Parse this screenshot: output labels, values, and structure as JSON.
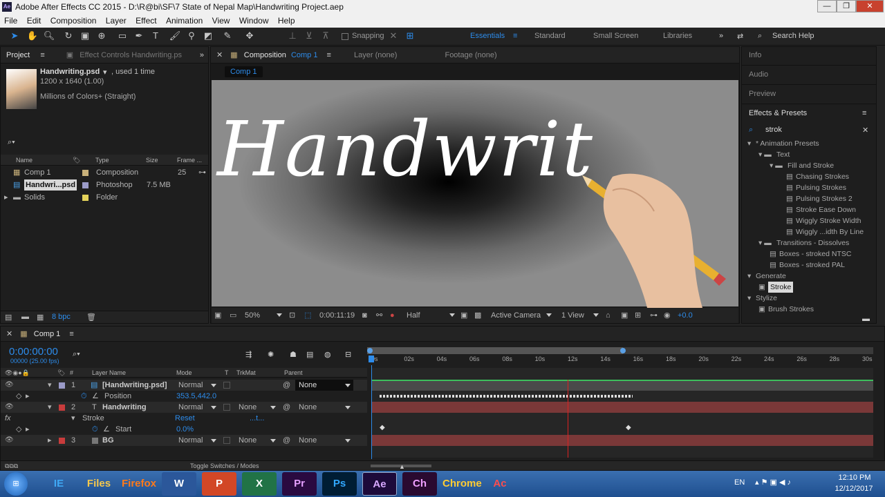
{
  "window": {
    "title": "Adobe After Effects CC 2015 - D:\\R@bi\\SF\\7 State of Nepal Map\\Handwriting Project.aep"
  },
  "menu": [
    "File",
    "Edit",
    "Composition",
    "Layer",
    "Effect",
    "Animation",
    "View",
    "Window",
    "Help"
  ],
  "toolbar": {
    "snapping": "Snapping",
    "workspaces": [
      "Essentials",
      "Standard",
      "Small Screen",
      "Libraries"
    ],
    "search_help": "Search Help"
  },
  "project_panel": {
    "tab": "Project",
    "effect_controls_tab": "Effect Controls Handwriting.ps",
    "asset_name": "Handwriting.psd",
    "asset_used": ", used 1 time",
    "asset_dims": "1200 x 1640 (1.00)",
    "asset_colors": "Millions of Colors+ (Straight)",
    "columns": [
      "Name",
      "Type",
      "Size",
      "Frame ..."
    ],
    "items": [
      {
        "name": "Comp 1",
        "type": "Composition",
        "size": "",
        "frame": "25",
        "color": "#c8b07a"
      },
      {
        "name": "Handwri...psd",
        "type": "Photoshop",
        "size": "7.5 MB",
        "frame": "",
        "color": "#9b9bc8"
      },
      {
        "name": "Solids",
        "type": "Folder",
        "size": "",
        "frame": "",
        "color": "#e4d25a"
      }
    ],
    "bpc": "8 bpc"
  },
  "composition_panel": {
    "tab_label": "Composition",
    "tab_comp": "Comp 1",
    "layer_tab": "Layer (none)",
    "footage_tab": "Footage (none)",
    "breadcrumb": "Comp 1",
    "canvas_text": "Handwrit",
    "zoom": "50%",
    "timecode": "0:00:11:19",
    "resolution": "Half",
    "camera": "Active Camera",
    "views": "1 View",
    "exposure": "+0.0"
  },
  "right_panel": {
    "info": "Info",
    "audio": "Audio",
    "preview": "Preview",
    "effects_title": "Effects & Presets",
    "search_value": "strok",
    "tree": [
      {
        "label": "* Animation Presets",
        "level": 0,
        "kind": "twirl"
      },
      {
        "label": "Text",
        "level": 1,
        "kind": "folder"
      },
      {
        "label": "Fill and Stroke",
        "level": 2,
        "kind": "folder"
      },
      {
        "label": "Chasing Strokes",
        "level": 3,
        "kind": "preset"
      },
      {
        "label": "Pulsing Strokes",
        "level": 3,
        "kind": "preset"
      },
      {
        "label": "Pulsing Strokes 2",
        "level": 3,
        "kind": "preset"
      },
      {
        "label": "Stroke Ease Down",
        "level": 3,
        "kind": "preset"
      },
      {
        "label": "Wiggly Stroke Width",
        "level": 3,
        "kind": "preset"
      },
      {
        "label": "Wiggly ...idth By Line",
        "level": 3,
        "kind": "preset"
      },
      {
        "label": "Transitions - Dissolves",
        "level": 1,
        "kind": "folder"
      },
      {
        "label": "Boxes - stroked NTSC",
        "level": 2,
        "kind": "preset"
      },
      {
        "label": "Boxes - stroked PAL",
        "level": 2,
        "kind": "preset"
      },
      {
        "label": "Generate",
        "level": 0,
        "kind": "twirl"
      },
      {
        "label": "Stroke",
        "level": 1,
        "kind": "effect",
        "selected": true
      },
      {
        "label": "Stylize",
        "level": 0,
        "kind": "twirl"
      },
      {
        "label": "Brush Strokes",
        "level": 1,
        "kind": "effect"
      }
    ]
  },
  "timeline": {
    "tab": "Comp 1",
    "timecode": "0:00:00:00",
    "fps": "00000 (25.00 fps)",
    "columns": [
      "#",
      "Layer Name",
      "Mode",
      "T",
      "TrkMat",
      "Parent"
    ],
    "ruler": [
      "0s",
      "02s",
      "04s",
      "06s",
      "08s",
      "10s",
      "12s",
      "14s",
      "16s",
      "18s",
      "20s",
      "22s",
      "24s",
      "26s",
      "28s",
      "30s"
    ],
    "layers": [
      {
        "num": "1",
        "name": "[Handwriting.psd]",
        "mode": "Normal",
        "trkmat": "",
        "parent": "None",
        "color": "#9b9bc8"
      },
      {
        "num": "2",
        "name": "Handwriting",
        "mode": "Normal",
        "trkmat": "None",
        "parent": "None",
        "color": "#c83c3c"
      },
      {
        "num": "3",
        "name": "BG",
        "mode": "Normal",
        "trkmat": "None",
        "parent": "None",
        "color": "#c83c3c"
      }
    ],
    "position_label": "Position",
    "position_value": "353.5,442.0",
    "stroke_label": "Stroke",
    "stroke_reset": "Reset",
    "stroke_dots": "...t...",
    "start_label": "Start",
    "start_value": "0.0%",
    "toggle": "Toggle Switches / Modes"
  },
  "taskbar": {
    "apps": [
      "IE",
      "Files",
      "Firefox",
      "W",
      "P",
      "X",
      "Pr",
      "Ps",
      "Ae",
      "Ch",
      "Chrome",
      "Ac"
    ],
    "lang": "EN",
    "time": "12:10 PM",
    "date": "12/12/2017"
  }
}
